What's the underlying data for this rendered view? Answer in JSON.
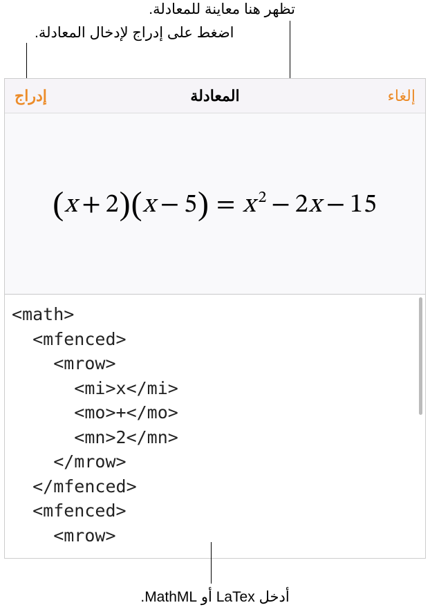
{
  "callouts": {
    "preview": "تظهر هنا معاينة للمعادلة.",
    "insert": "اضغط على إدراج لإدخال المعادلة.",
    "input": "أدخل LaTex أو MathML."
  },
  "header": {
    "title": "المعادلة",
    "insert_label": "إدراج",
    "cancel_label": "إلغاء"
  },
  "equation_preview": {
    "display": "(x + 2)(x − 5) = x² − 2x − 15",
    "lhs_factor1_var": "x",
    "lhs_factor1_op": "+",
    "lhs_factor1_const": "2",
    "lhs_factor2_var": "x",
    "lhs_factor2_op": "−",
    "lhs_factor2_const": "5",
    "eq": "=",
    "rhs_term1_base": "x",
    "rhs_term1_exp": "2",
    "rhs_op1": "−",
    "rhs_term2": "2x",
    "rhs_op2": "−",
    "rhs_term3": "15"
  },
  "code_input": {
    "text": "<math>\n  <mfenced>\n    <mrow>\n      <mi>x</mi>\n      <mo>+</mo>\n      <mn>2</mn>\n    </mrow>\n  </mfenced>\n  <mfenced>\n    <mrow>"
  }
}
